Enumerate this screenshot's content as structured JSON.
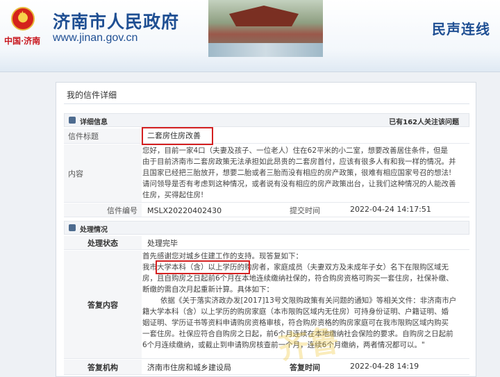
{
  "header": {
    "site_title": "济南市人民政府",
    "site_url": "www.jinan.gov.cn",
    "logo_sub": "中国·济南",
    "section_title": "民声连线"
  },
  "panel": {
    "tab_label": "我的信件详细"
  },
  "detail": {
    "section_label": "详细信息",
    "follow_text": "已有162人关注该问题",
    "title_label": "信件标题",
    "title_value": "二套房住房改善",
    "content_label": "内容",
    "content_lines": [
      "您好，目前一家4口（夫妻及孩子、一位老人）住在62平米的小二室，想要改善居住条件，但是",
      "由于目前济南市二套房政策无法承担如此昂贵的二套房首付，应该有很多人有和我一样的情况。并",
      "且国家已经把三胎放开，想要二胎或者三胎而没有相应的房产政策，很难有相应国家号召的想法!",
      "请问领导是否有考虑到这种情况，或者说有没有相应的房产政策出台，让我们这种情况的人能改善",
      "住房，买得起住房!"
    ],
    "id_label": "信件编号",
    "id_value": "MSLX20220402430",
    "submit_label": "提交时间",
    "submit_value": "2022-04-24 14:17:51"
  },
  "handling": {
    "section_label": "处理情况",
    "status_label": "处理状态",
    "status_value": "处理完毕",
    "reply_label": "答复内容",
    "reply_lines": [
      "首先感谢您对城乡住建工作的支持。现答复如下：",
      "我市大学本科（含）以上学历的购房者，家庭成员（夫妻双方及未成年子女）名下在限购区域无",
      "房，且自购房之日起前6个月在本地连续缴纳社保的，符合购房资格可购买一套住房，社保补缴、",
      "断缴的需自次月起重新计算。具体如下：",
      "依据《关于落实济政办发[2017]13号文限购政策有关问题的通知》等相关文件：非济南市户",
      "籍大学本科（含）以上学历的购房家庭（本市限购区域内无住房）可持身份证明、户籍证明、婚",
      "姻证明、学历证书等资料申请购房资格审核，符合购房资格的购房家庭可在我市限购区域内购买",
      "一套住房。社保应符合自购房之日起，前6个月连续在本地缴纳社会保险的要求。自购房之日起前",
      "6个月连续缴纳，或截止到申请购房核查前一个月，连续6个月缴纳，两者情况都可以。\""
    ],
    "org_label": "答复机构",
    "org_value": "济南市住房和城乡建设局",
    "reply_time_label": "答复时间",
    "reply_time_value": "2022-04-28 14:19"
  }
}
